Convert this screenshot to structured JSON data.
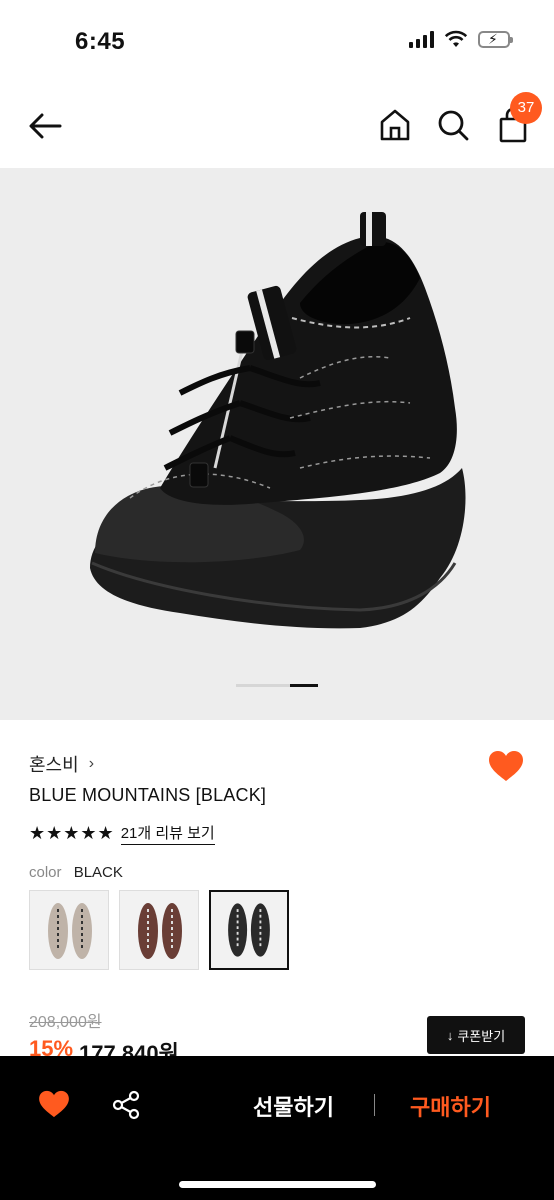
{
  "status_bar": {
    "time": "6:45"
  },
  "nav": {
    "cart_count": "37"
  },
  "carousel": {
    "total": 2,
    "current": 2
  },
  "product": {
    "brand": "혼스비",
    "name": "BLUE MOUNTAINS [BLACK]",
    "stars": "★★★★★",
    "rating": 5,
    "reviews_link": "21개 리뷰 보기",
    "color_label": "color",
    "color_value": "BLACK",
    "swatches": [
      "beige",
      "brown",
      "black"
    ],
    "selected_swatch": "black",
    "original_price": "208,000원",
    "discount": "15%",
    "price": "177,840원",
    "coupon_label": "쿠폰받기"
  },
  "bottom_bar": {
    "gift_label": "선물하기",
    "buy_label": "구매하기"
  },
  "colors": {
    "accent": "#ff5a1f",
    "bar": "#000000"
  },
  "icons": [
    "back-arrow-icon",
    "home-icon",
    "search-icon",
    "shopping-bag-icon",
    "heart-icon",
    "share-icon",
    "download-icon"
  ]
}
